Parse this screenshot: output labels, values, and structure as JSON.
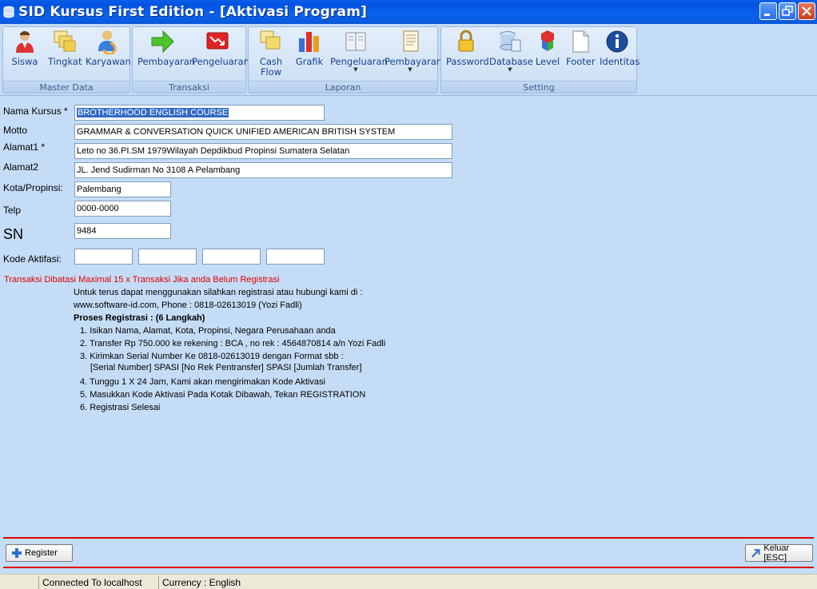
{
  "window": {
    "title": "SID Kursus First Edition - [Aktivasi Program]"
  },
  "ribbon": {
    "groups": [
      {
        "caption": "Master Data",
        "buttons": [
          {
            "label": "Siswa",
            "icon": "user-icon"
          },
          {
            "label": "Tingkat",
            "icon": "layers-icon"
          },
          {
            "label": "Karyawan",
            "icon": "users-icon"
          }
        ]
      },
      {
        "caption": "Transaksi",
        "buttons": [
          {
            "label": "Pembayaran",
            "icon": "arrow-right-icon"
          },
          {
            "label": "Pengeluaran",
            "icon": "chart-down-icon"
          }
        ]
      },
      {
        "caption": "Laporan",
        "buttons": [
          {
            "label": "Cash",
            "label2": "Flow",
            "icon": "cashflow-icon"
          },
          {
            "label": "Grafik",
            "icon": "bar-chart-icon"
          },
          {
            "label": "Pengeluaran",
            "icon": "book-icon",
            "dropdown": true
          },
          {
            "label": "Pembayaran",
            "icon": "document-icon",
            "dropdown": true
          }
        ]
      },
      {
        "caption": "Setting",
        "buttons": [
          {
            "label": "Password",
            "icon": "lock-icon"
          },
          {
            "label": "Database",
            "icon": "database-icon",
            "dropdown": true
          },
          {
            "label": "Level",
            "icon": "cubes-icon"
          },
          {
            "label": "Footer",
            "icon": "page-icon"
          },
          {
            "label": "Identitas",
            "icon": "info-icon"
          }
        ]
      }
    ]
  },
  "form": {
    "nama_kursus": {
      "label": "Nama Kursus *",
      "value": "BROTHERHOOD ENGLISH COURSE"
    },
    "motto": {
      "label": "Motto",
      "value": "GRAMMAR & CONVERSATION QUICK UNIFIED AMERICAN BRITISH SYSTEM"
    },
    "alamat1": {
      "label": "Alamat1 *",
      "value": "Leto no 36.PI.SM 1979Wilayah Depdikbud Propinsi Sumatera Selatan"
    },
    "alamat2": {
      "label": "Alamat2",
      "value": "JL. Jend Sudirman No 3108 A Pelambang"
    },
    "kota": {
      "label": "Kota/Propinsi:",
      "value": "Palembang"
    },
    "telp": {
      "label": "Telp",
      "value": "0000-0000"
    },
    "sn": {
      "label": "SN",
      "value": "9484"
    },
    "kode": {
      "label": "Kode Aktifasi:",
      "values": [
        "",
        "",
        "",
        ""
      ]
    }
  },
  "info": {
    "warning": "Transaksi Dibatasi Maximal 15 x Transaksi Jika anda Belum Registrasi",
    "line1": "Untuk terus dapat menggunakan silahkan registrasi atau hubungi kami di :",
    "line2": "www.software-id.com, Phone : 0818-02613019 (Yozi Fadli)",
    "heading": "Proses Registrasi : (6 Langkah)",
    "steps": [
      "1. Isikan Nama, Alamat, Kota, Propinsi, Negara Perusahaan anda",
      "2. Transfer Rp 750.000 ke rekening : BCA , no rek : 4564870814 a/n Yozi Fadli",
      "3. Kirimkan Serial Number Ke 0818-02613019 dengan Format sbb :",
      "[Serial Number] SPASI [No Rek Pentransfer] SPASI [Jumlah Transfer]",
      "4. Tunggu 1 X 24 Jam, Kami akan mengirimakan Kode Aktivasi",
      "5. Masukkan Kode Aktivasi Pada Kotak Dibawah, Tekan REGISTRATION",
      "6. Registrasi Selesai"
    ]
  },
  "buttons": {
    "register": "Register",
    "keluar": "Keluar [ESC]"
  },
  "status": {
    "connection": "Connected To localhost",
    "currency": "Currency : English"
  }
}
